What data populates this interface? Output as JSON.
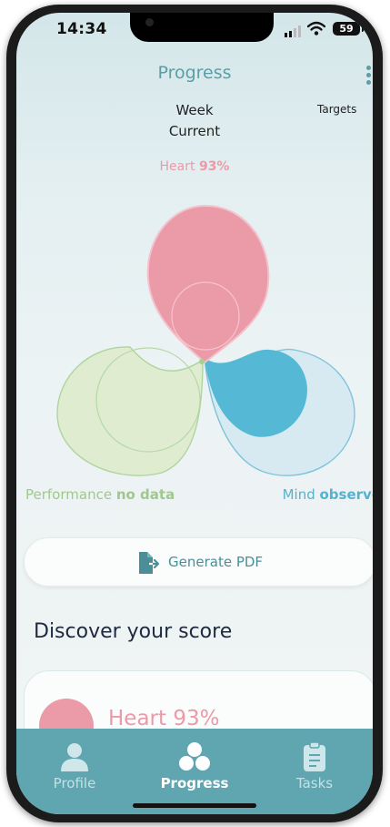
{
  "status_bar": {
    "time": "14:34",
    "battery": "59"
  },
  "header": {
    "title": "Progress",
    "period": "Week",
    "range": "Current",
    "targets_label": "Targets"
  },
  "chart": {
    "heart": {
      "name": "Heart",
      "value": "93%",
      "color": "#eb9aa8"
    },
    "performance": {
      "name": "Performance",
      "value": "no data",
      "color": "#a8d094"
    },
    "mind": {
      "name": "Mind",
      "value": "observe",
      "color": "#55b9d6"
    }
  },
  "actions": {
    "generate_pdf_label": "Generate PDF"
  },
  "discover": {
    "heading": "Discover your score",
    "card_label": "Heart 93%"
  },
  "tabbar": {
    "active": "Progress",
    "tabs": [
      {
        "label": "Profile",
        "icon": "person-icon"
      },
      {
        "label": "Progress",
        "icon": "three-petal-icon"
      },
      {
        "label": "Tasks",
        "icon": "clipboard-icon"
      }
    ]
  },
  "colors": {
    "accent": "#5c9ea5",
    "tabbar_bg": "#5fa6b1",
    "heading": "#1e2a40"
  }
}
